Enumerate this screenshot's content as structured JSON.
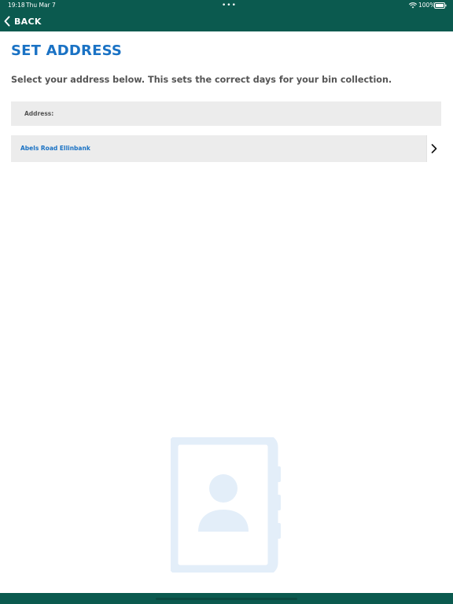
{
  "status_bar": {
    "time": "19:18",
    "date": "Thu Mar 7",
    "dots": "•••",
    "battery": "100%"
  },
  "nav": {
    "back_label": "BACK"
  },
  "page": {
    "title": "SET ADDRESS",
    "instructions": "Select your address below. This sets the correct days for your bin collection."
  },
  "address_list": {
    "header_label": "Address:",
    "items": [
      {
        "label": "Abels Road Ellinbank"
      }
    ]
  },
  "colors": {
    "header_green": "#0b5a4f",
    "accent_blue": "#1a72c4",
    "row_gray": "#ececec",
    "illustration": "#e3eef9"
  },
  "icons": {
    "back": "chevron-left-icon",
    "row_arrow": "chevron-right-icon",
    "illustration": "contact-book-icon"
  }
}
